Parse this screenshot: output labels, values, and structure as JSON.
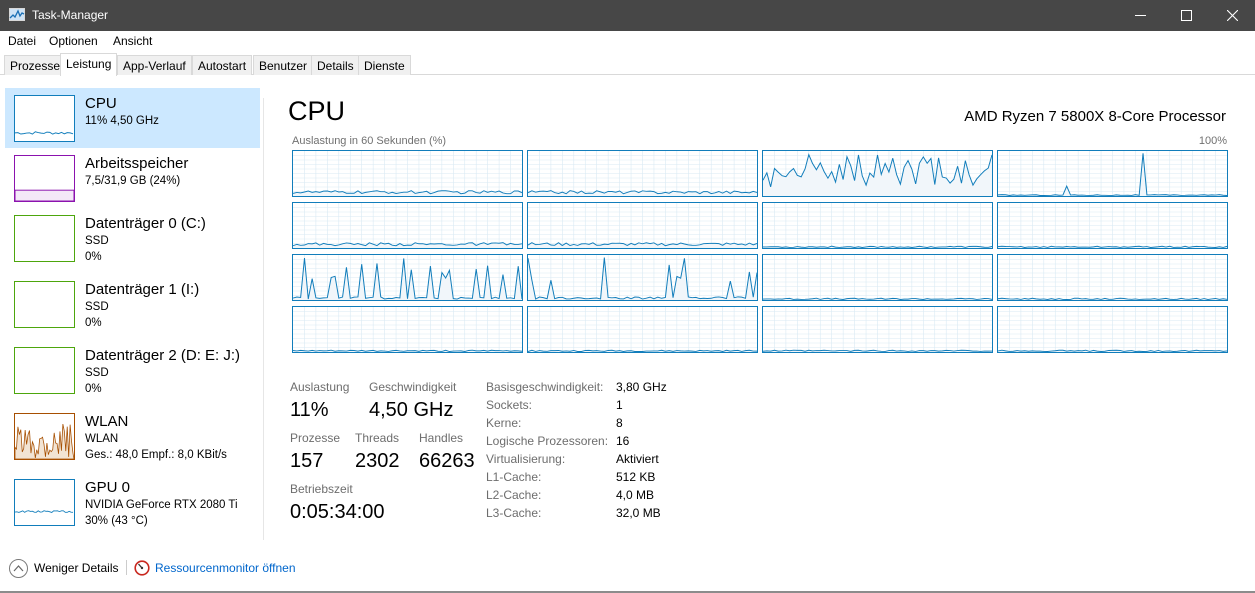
{
  "window": {
    "title": "Task-Manager"
  },
  "menu": [
    "Datei",
    "Optionen",
    "Ansicht"
  ],
  "tabs": [
    "Prozesse",
    "Leistung",
    "App-Verlauf",
    "Autostart",
    "Benutzer",
    "Details",
    "Dienste"
  ],
  "active_tab": "Leistung",
  "sidebar": [
    {
      "name": "CPU",
      "sub": [
        "11% 4,50 GHz"
      ],
      "color": "#117dbb",
      "selected": true
    },
    {
      "name": "Arbeitsspeicher",
      "sub": [
        "7,5/31,9 GB (24%)"
      ],
      "color": "#8b12ae",
      "fill": 0.24
    },
    {
      "name": "Datenträger 0 (C:)",
      "sub": [
        "SSD",
        "0%"
      ],
      "color": "#4da60c"
    },
    {
      "name": "Datenträger 1 (I:)",
      "sub": [
        "SSD",
        "0%"
      ],
      "color": "#4da60c"
    },
    {
      "name": "Datenträger 2 (D: E: J:)",
      "sub": [
        "SSD",
        "0%"
      ],
      "color": "#4da60c"
    },
    {
      "name": "WLAN",
      "sub": [
        "WLAN",
        "Ges.: 48,0  Empf.: 8,0 KBit/s"
      ],
      "color": "#a74f01"
    },
    {
      "name": "GPU 0",
      "sub": [
        "NVIDIA GeForce RTX 2080 Ti",
        "30% (43 °C)"
      ],
      "color": "#117dbb"
    }
  ],
  "cpu": {
    "title": "CPU",
    "processor": "AMD Ryzen 7 5800X 8-Core Processor",
    "graph_label": "Auslastung in 60 Sekunden (%)",
    "graph_max": "100%",
    "line_color": "#117dbb",
    "stats": {
      "auslastung_label": "Auslastung",
      "auslastung": "11%",
      "geschwindigkeit_label": "Geschwindigkeit",
      "geschwindigkeit": "4,50 GHz",
      "prozesse_label": "Prozesse",
      "prozesse": "157",
      "threads_label": "Threads",
      "threads": "2302",
      "handles_label": "Handles",
      "handles": "66263",
      "betriebszeit_label": "Betriebszeit",
      "betriebszeit": "0:05:34:00"
    },
    "details": [
      {
        "key": "Basisgeschwindigkeit:",
        "value": "3,80 GHz"
      },
      {
        "key": "Sockets:",
        "value": "1"
      },
      {
        "key": "Kerne:",
        "value": "8"
      },
      {
        "key": "Logische Prozessoren:",
        "value": "16"
      },
      {
        "key": "Virtualisierung:",
        "value": "Aktiviert"
      },
      {
        "key": "L1-Cache:",
        "value": "512 KB"
      },
      {
        "key": "L2-Cache:",
        "value": "4,0 MB"
      },
      {
        "key": "L3-Cache:",
        "value": "32,0 MB"
      }
    ]
  },
  "footer": {
    "less_details": "Weniger Details",
    "resmon": "Ressourcenmonitor öffnen"
  }
}
